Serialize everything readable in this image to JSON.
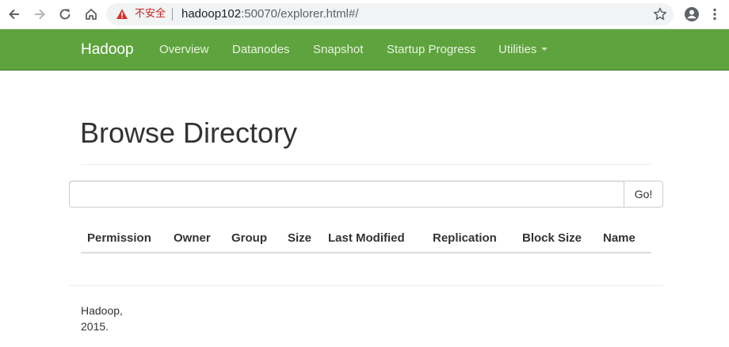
{
  "browser": {
    "security_label": "不安全",
    "url_host": "hadoop102",
    "url_rest": ":50070/explorer.html#/"
  },
  "navbar": {
    "brand": "Hadoop",
    "links": [
      {
        "label": "Overview"
      },
      {
        "label": "Datanodes"
      },
      {
        "label": "Snapshot"
      },
      {
        "label": "Startup Progress"
      },
      {
        "label": "Utilities",
        "dropdown": true
      }
    ],
    "color": "#5fa33e"
  },
  "main": {
    "title": "Browse Directory",
    "search": {
      "value": "",
      "placeholder": "",
      "button_label": "Go!"
    },
    "table": {
      "columns": [
        "Permission",
        "Owner",
        "Group",
        "Size",
        "Last Modified",
        "Replication",
        "Block Size",
        "Name"
      ],
      "rows": []
    }
  },
  "footer": {
    "line1": "Hadoop,",
    "line2": "2015."
  }
}
